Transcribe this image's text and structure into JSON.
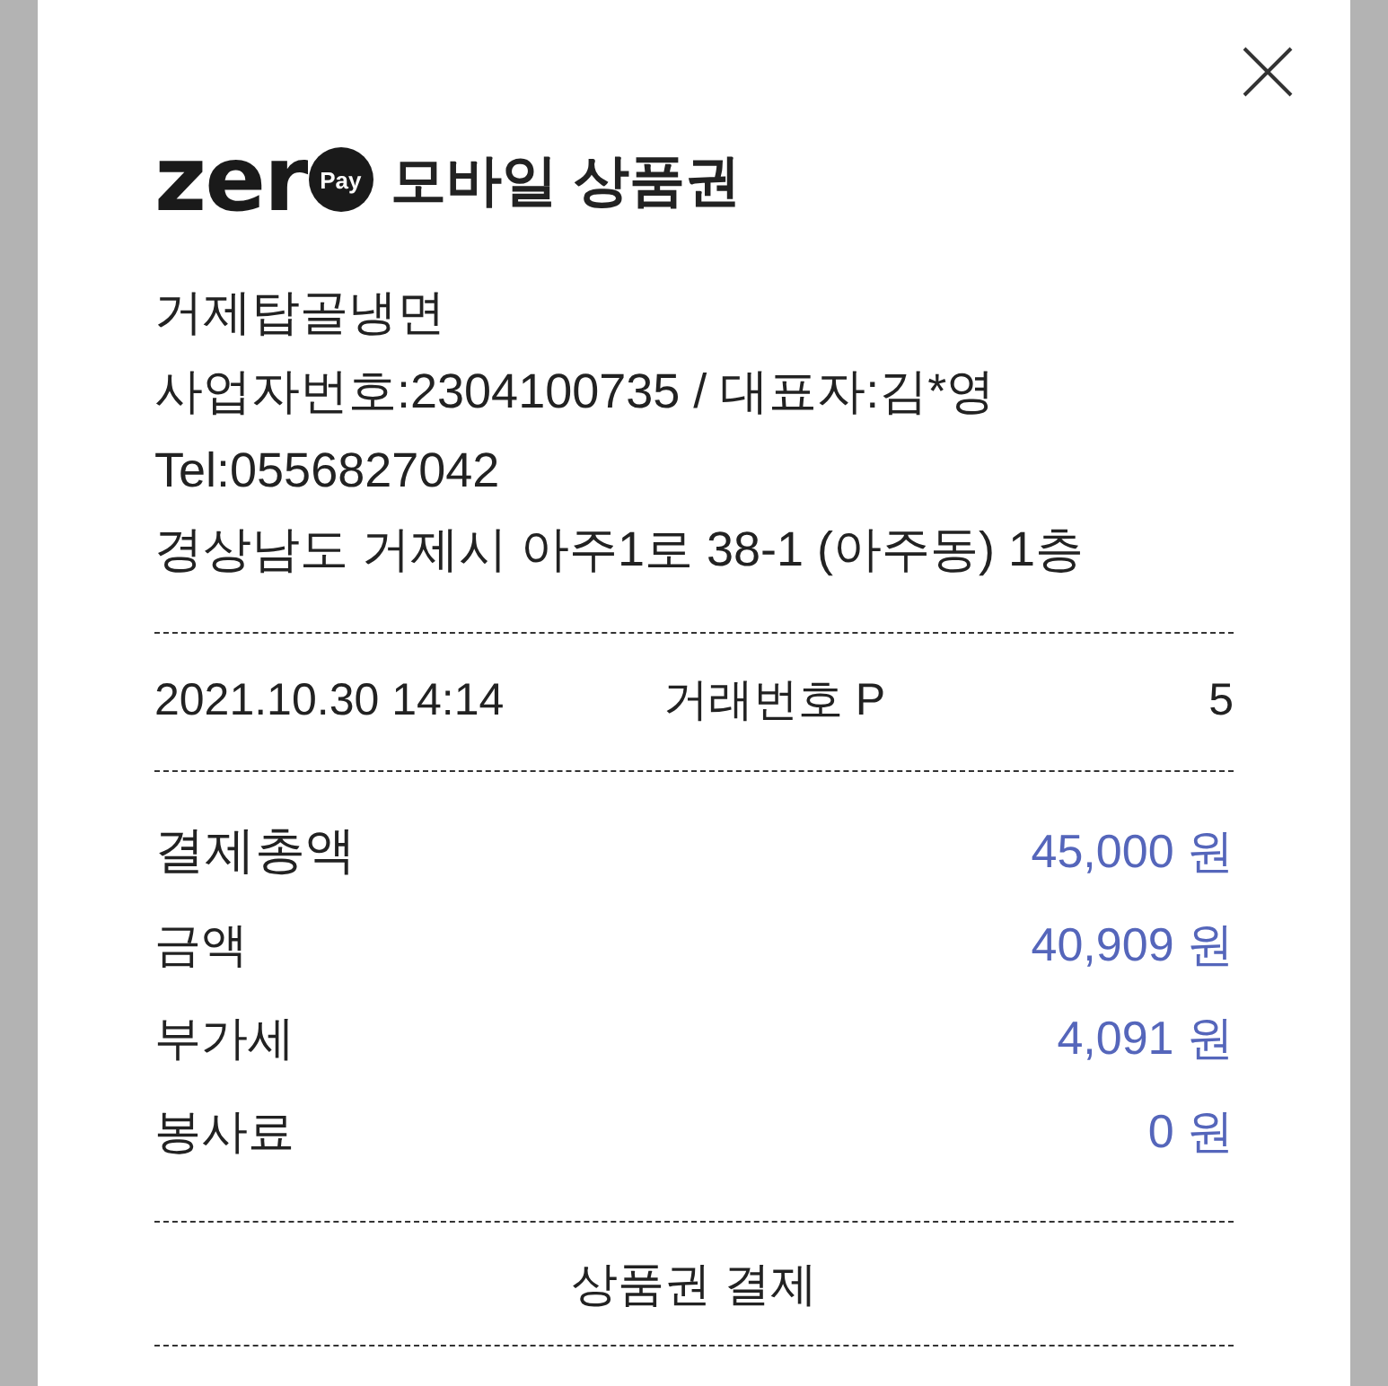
{
  "logo": {
    "wordmark": "zer",
    "badge": "Pay"
  },
  "title": "모바일 상품권",
  "merchant": {
    "name": "거제탑골냉면",
    "business_info": "사업자번호:2304100735 / 대표자:김*영",
    "tel": "Tel:0556827042",
    "address": "경상남도 거제시 아주1로 38-1 (아주동) 1층"
  },
  "transaction": {
    "datetime": "2021.10.30 14:14",
    "number_start": "거래번호 P",
    "number_end": "5"
  },
  "amounts": [
    {
      "kind": "total",
      "label": "결제총액",
      "value": "45,000 원"
    },
    {
      "kind": "line",
      "label": "금액",
      "value": "40,909 원"
    },
    {
      "kind": "line",
      "label": "부가세",
      "value": "4,091 원"
    },
    {
      "kind": "line",
      "label": "봉사료",
      "value": "0 원"
    }
  ],
  "footer": "상품권 결제"
}
